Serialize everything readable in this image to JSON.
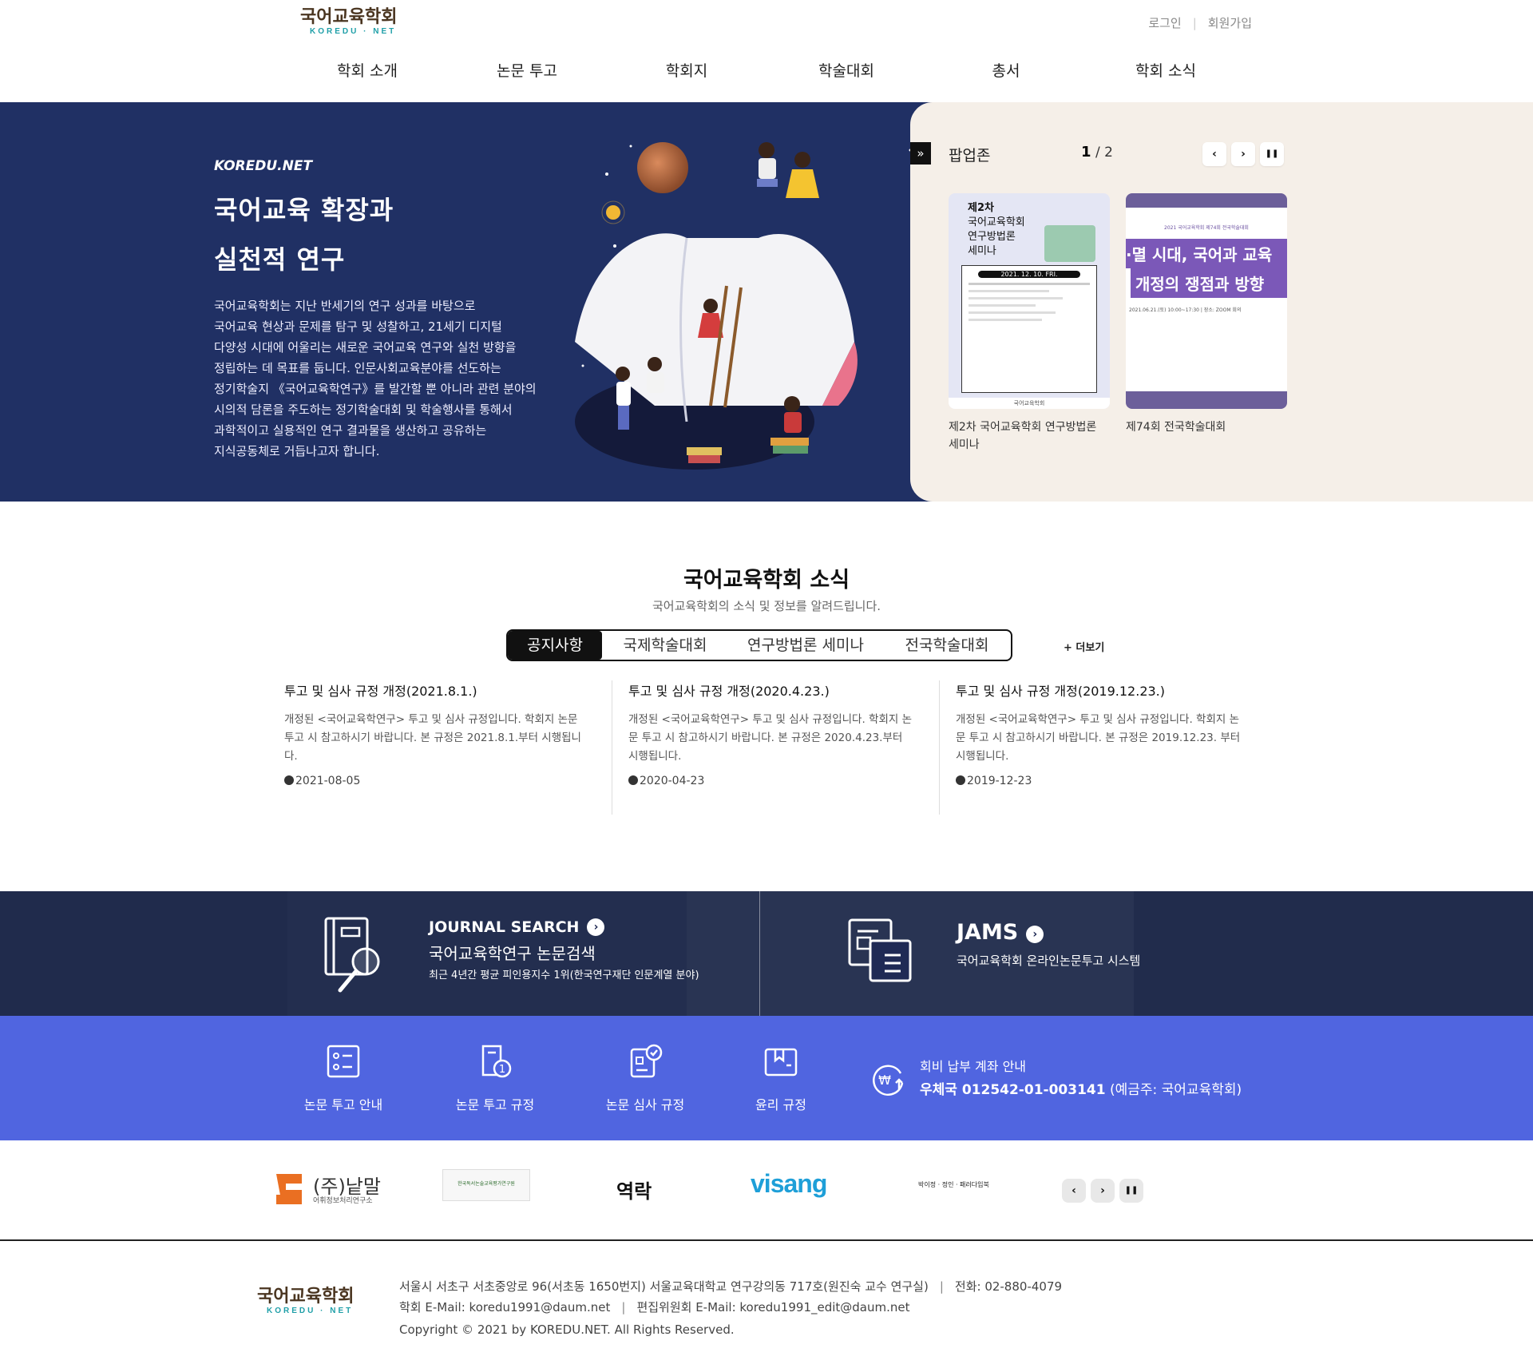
{
  "header": {
    "logo_ko": "국어교육학회",
    "logo_en": "KOREDU · NET",
    "login": "로그인",
    "join": "회원가입",
    "nav": [
      "학회 소개",
      "논문 투고",
      "학회지",
      "학술대회",
      "총서",
      "학회 소식"
    ]
  },
  "hero": {
    "brand": "KOREDU.NET",
    "title_line1": "국어교육 확장과",
    "title_line2": "실천적 연구",
    "desc": [
      "국어교육학회는 지난 반세기의 연구 성과를 바탕으로",
      "국어교육 현상과 문제를 탐구 및 성찰하고, 21세기 디지털",
      "다양성 시대에 어울리는 새로운 국어교육 연구와 실천 방향을",
      "정립하는 데 목표를 둡니다. 인문사회교육분야를 선도하는",
      "정기학술지 《국어교육학연구》를 발간할 뿐 아니라 관련 분야의",
      "시의적 담론을 주도하는 정기학술대회 및 학술행사를 통해서",
      "과학적이고 실용적인 연구 결과물을 생산하고 공유하는",
      "지식공동체로 거듭나고자 합니다."
    ]
  },
  "popup": {
    "toggle": "»",
    "title": "팝업존",
    "current": "1",
    "total": "/ 2",
    "prev": "‹",
    "next": "›",
    "pause": "❚❚",
    "cards": [
      {
        "caption": "제2차 국어교육학회 연구방법론 세미나",
        "poster_line1": "제2차",
        "poster_line2": "국어교육학회",
        "poster_line3": "연구방법론",
        "poster_line4": "세미나",
        "poster_date": "2021. 12. 10. FRI.",
        "poster_footer": "국어교육학회"
      },
      {
        "caption": "제74회 전국학술대회",
        "poster_top": "2021 국어교육학회 제74회 전국학술대회",
        "poster_line1": "·멸 시대, 국어과 교육",
        "poster_line2": "개정의 쟁점과 방향",
        "poster_small": "2021.06.21.(토) 10:00~17:30 | 장소: ZOOM 회의"
      }
    ]
  },
  "news": {
    "title": "국어교육학회 소식",
    "subtitle": "국어교육학회의 소식 및 정보를 알려드립니다.",
    "tabs": [
      "공지사항",
      "국제학술대회",
      "연구방법론 세미나",
      "전국학술대회"
    ],
    "more": "+ 더보기",
    "items": [
      {
        "title": "투고 및 심사 규정 개정(2021.8.1.)",
        "desc": "개정된 <국어교육학연구> 투고 및 심사 규정입니다. 학회지 논문 투고 시 참고하시기 바랍니다. 본 규정은 2021.8.1.부터 시행됩니다.",
        "date": "2021-08-05"
      },
      {
        "title": "투고 및 심사 규정 개정(2020.4.23.)",
        "desc": "개정된 <국어교육학연구> 투고 및 심사 규정입니다. 학회지 논문 투고 시 참고하시기 바랍니다. 본 규정은 2020.4.23.부터 시행됩니다.",
        "date": "2020-04-23"
      },
      {
        "title": "투고 및 심사 규정 개정(2019.12.23.)",
        "desc": "개정된 <국어교육학연구> 투고 및 심사 규정입니다. 학회지 논문 투고 시 참고하시기 바랍니다. 본 규정은 2019.12.23. 부터 시행됩니다.",
        "date": "2019-12-23"
      }
    ]
  },
  "banner": {
    "journal_head": "JOURNAL SEARCH",
    "journal_title": "국어교육학연구 논문검색",
    "journal_desc": "최근 4년간 평균 피인용지수 1위(한국연구재단 인문계열 분야)",
    "jams_head": "JAMS",
    "jams_desc": "국어교육학회 온라인논문투고 시스템",
    "arrow": "›"
  },
  "quick": {
    "items": [
      "논문 투고 안내",
      "논문 투고 규정",
      "논문 심사 규정",
      "윤리 규정"
    ],
    "account_title": "회비 납부 계좌 안내",
    "account_number": "우체국 012542-01-003141",
    "account_holder": " (예금주: 국어교육학회)",
    "won_symbol": "₩"
  },
  "partners": {
    "logos": [
      "(주)낱말",
      "어휘정보처리연구소",
      "한국독서논술교육평가연구원",
      "역락",
      "visang",
      "박이정 · 정인 · 패러다임북"
    ],
    "prev": "‹",
    "next": "›",
    "pause": "❚❚"
  },
  "footer": {
    "address": "서울시 서초구 서초중앙로 96(서초동 1650번지) 서울교육대학교 연구강의동 717호(원진숙 교수 연구실)",
    "phone": "전화: 02-880-4079",
    "email": "학회 E-Mail: koredu1991@daum.net",
    "edit_email": "편집위원회 E-Mail: koredu1991_edit@daum.net",
    "copyright": "Copyright © 2021 by KOREDU.NET. All Rights Reserved."
  },
  "colors": {
    "hero_bg": "#203064",
    "popup_bg": "#f5efe8",
    "quick_bg": "#5065e0",
    "banner_bg": "#2a334f"
  }
}
